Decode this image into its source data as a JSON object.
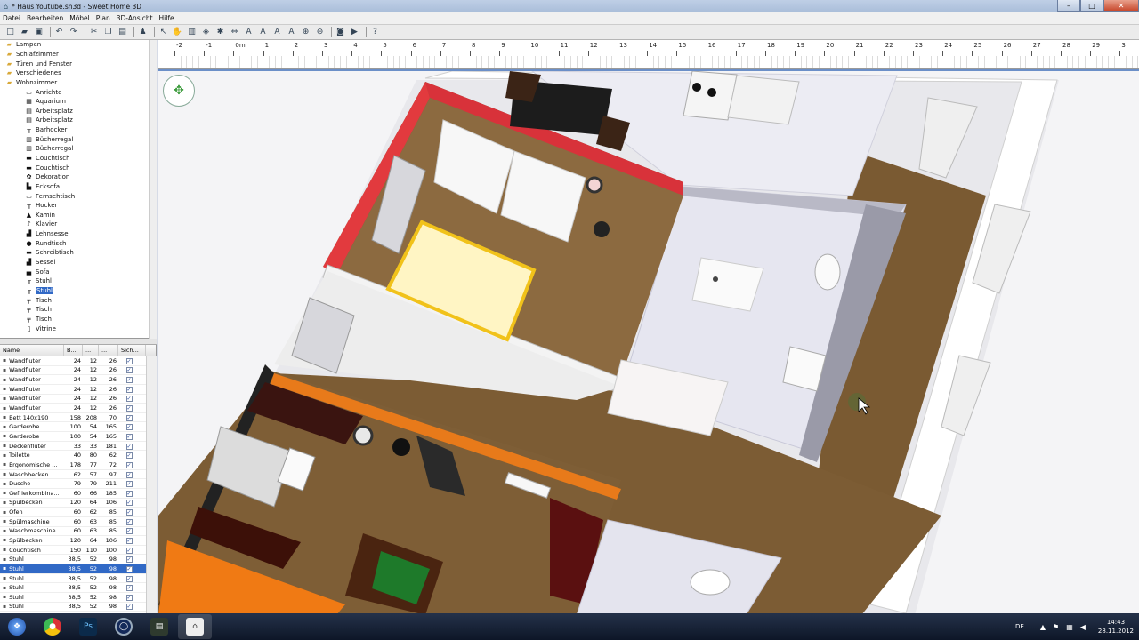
{
  "window": {
    "title": "* Haus Youtube.sh3d - Sweet Home 3D",
    "min_glyph": "–",
    "max_glyph": "□",
    "close_glyph": "✕"
  },
  "menu": [
    "Datei",
    "Bearbeiten",
    "Möbel",
    "Plan",
    "3D-Ansicht",
    "Hilfe"
  ],
  "tree": [
    {
      "label": "Lampen",
      "cat": true
    },
    {
      "label": "Schlafzimmer",
      "cat": true
    },
    {
      "label": "Türen und Fenster",
      "cat": true
    },
    {
      "label": "Verschiedenes",
      "cat": true
    },
    {
      "label": "Wohnzimmer",
      "cat": true
    },
    {
      "label": "Anrichte",
      "cat": false,
      "icon": "▭"
    },
    {
      "label": "Aquarium",
      "cat": false,
      "icon": "▦"
    },
    {
      "label": "Arbeitsplatz",
      "cat": false,
      "icon": "▤"
    },
    {
      "label": "Arbeitsplatz",
      "cat": false,
      "icon": "▤"
    },
    {
      "label": "Barhocker",
      "cat": false,
      "icon": "╥"
    },
    {
      "label": "Bücherregal",
      "cat": false,
      "icon": "▥"
    },
    {
      "label": "Bücherregal",
      "cat": false,
      "icon": "▥"
    },
    {
      "label": "Couchtisch",
      "cat": false,
      "icon": "▬"
    },
    {
      "label": "Couchtisch",
      "cat": false,
      "icon": "▬"
    },
    {
      "label": "Dekoration",
      "cat": false,
      "icon": "✿"
    },
    {
      "label": "Ecksofa",
      "cat": false,
      "icon": "▙"
    },
    {
      "label": "Fernsehtisch",
      "cat": false,
      "icon": "▭"
    },
    {
      "label": "Hocker",
      "cat": false,
      "icon": "╥"
    },
    {
      "label": "Kamin",
      "cat": false,
      "icon": "▲"
    },
    {
      "label": "Klavier",
      "cat": false,
      "icon": "♪"
    },
    {
      "label": "Lehnsessel",
      "cat": false,
      "icon": "▟"
    },
    {
      "label": "Rundtisch",
      "cat": false,
      "icon": "●"
    },
    {
      "label": "Schreibtisch",
      "cat": false,
      "icon": "▬"
    },
    {
      "label": "Sessel",
      "cat": false,
      "icon": "▟"
    },
    {
      "label": "Sofa",
      "cat": false,
      "icon": "▄"
    },
    {
      "label": "Stuhl",
      "cat": false,
      "icon": "╓"
    },
    {
      "label": "Stuhl",
      "cat": false,
      "icon": "╓",
      "selected": true
    },
    {
      "label": "Tisch",
      "cat": false,
      "icon": "╤"
    },
    {
      "label": "Tisch",
      "cat": false,
      "icon": "╤"
    },
    {
      "label": "Tisch",
      "cat": false,
      "icon": "╤"
    },
    {
      "label": "Vitrine",
      "cat": false,
      "icon": "▯"
    }
  ],
  "table": {
    "headers": [
      "Name",
      "B...",
      "...",
      "...",
      "Sich..."
    ],
    "rows": [
      [
        "Wandfluter",
        "24",
        "12",
        "26",
        "✓"
      ],
      [
        "Wandfluter",
        "24",
        "12",
        "26",
        "✓"
      ],
      [
        "Wandfluter",
        "24",
        "12",
        "26",
        "✓"
      ],
      [
        "Wandfluter",
        "24",
        "12",
        "26",
        "✓"
      ],
      [
        "Wandfluter",
        "24",
        "12",
        "26",
        "✓"
      ],
      [
        "Wandfluter",
        "24",
        "12",
        "26",
        "✓"
      ],
      [
        "Bett 140x190",
        "158",
        "208",
        "70",
        "✓"
      ],
      [
        "Garderobe",
        "100",
        "54",
        "165",
        "✓"
      ],
      [
        "Garderobe",
        "100",
        "54",
        "165",
        "✓"
      ],
      [
        "Deckenfluter",
        "33",
        "33",
        "181",
        "✓"
      ],
      [
        "Toilette",
        "40",
        "80",
        "62",
        "✓"
      ],
      [
        "Ergonomische ...",
        "178",
        "77",
        "72",
        "✓"
      ],
      [
        "Waschbecken ...",
        "62",
        "57",
        "97",
        "✓"
      ],
      [
        "Dusche",
        "79",
        "79",
        "211",
        "✓"
      ],
      [
        "Gefrierkombina...",
        "60",
        "66",
        "185",
        "✓"
      ],
      [
        "Spülbecken",
        "120",
        "64",
        "106",
        "✓"
      ],
      [
        "Ofen",
        "60",
        "62",
        "85",
        "✓"
      ],
      [
        "Spülmaschine",
        "60",
        "63",
        "85",
        "✓"
      ],
      [
        "Waschmaschine",
        "60",
        "63",
        "85",
        "✓"
      ],
      [
        "Spülbecken",
        "120",
        "64",
        "106",
        "✓"
      ],
      [
        "Couchtisch",
        "150",
        "110",
        "100",
        "✓"
      ],
      [
        "Stuhl",
        "38,5",
        "52",
        "98",
        "✓"
      ],
      [
        "Stuhl",
        "38,5",
        "52",
        "98",
        "✓"
      ],
      [
        "Stuhl",
        "38,5",
        "52",
        "98",
        "✓"
      ],
      [
        "Stuhl",
        "38,5",
        "52",
        "98",
        "✓"
      ],
      [
        "Stuhl",
        "38,5",
        "52",
        "98",
        "✓"
      ],
      [
        "Stuhl",
        "38,5",
        "52",
        "98",
        "✓"
      ]
    ],
    "selected_index": 22
  },
  "ruler": [
    "-2",
    "-1",
    "0m",
    "1",
    "2",
    "3",
    "4",
    "5",
    "6",
    "7",
    "8",
    "9",
    "10",
    "11",
    "12",
    "13",
    "14",
    "15",
    "16",
    "17",
    "18",
    "19",
    "20",
    "21",
    "22",
    "23",
    "24",
    "25",
    "26",
    "27",
    "28",
    "29",
    "3"
  ],
  "taskbar": {
    "lang": "DE",
    "time": "14:43",
    "date": "28.11.2012",
    "ps_label": "Ps"
  }
}
